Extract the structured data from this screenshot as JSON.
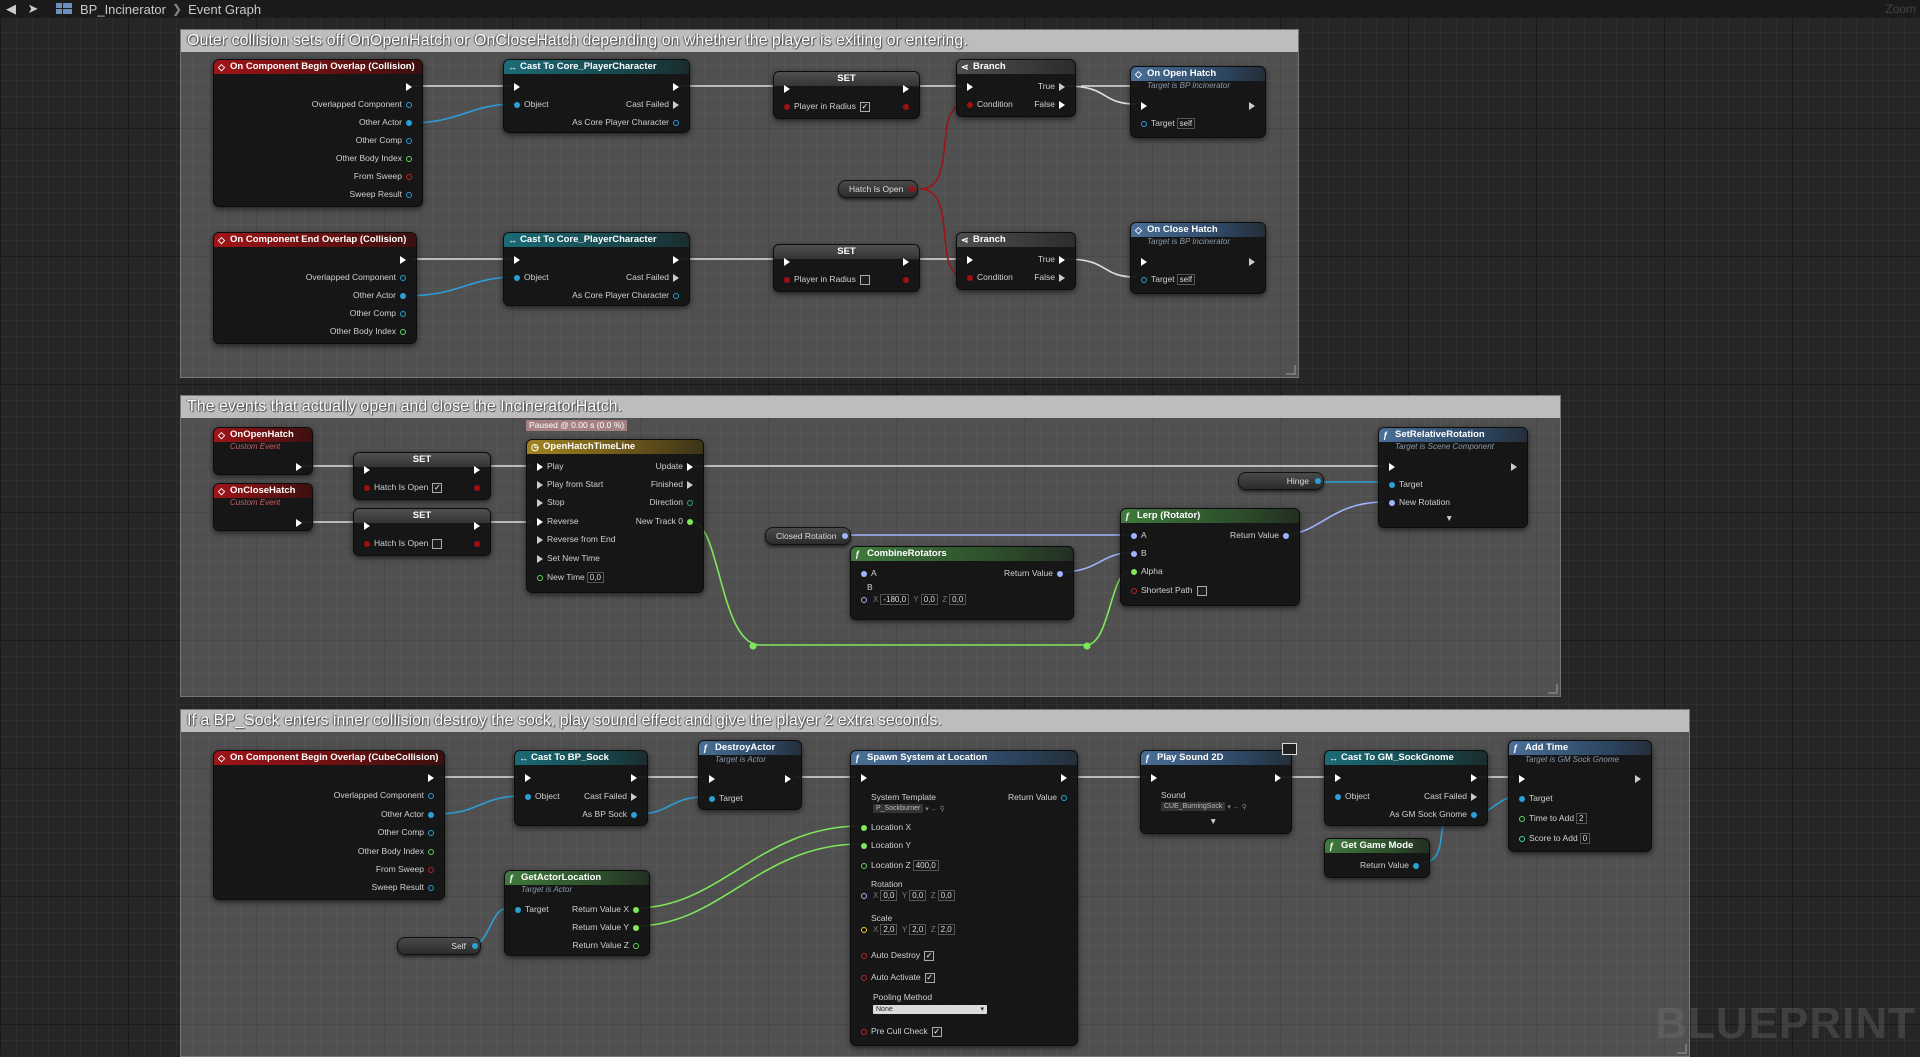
{
  "topbar": {
    "blueprint_name": "BP_Incinerator",
    "graph_name": "Event Graph",
    "zoom_label": "Zoom"
  },
  "watermark": "BLUEPRINT",
  "comments": [
    {
      "title": "Outer collision sets off OnOpenHatch or OnCloseHatch depending on whether the player is exiting or entering."
    },
    {
      "title": "The events that actually open and close the IncineratorHatch."
    },
    {
      "title": "If a BP_Sock enters inner collision destroy the sock, play sound effect and give the player 2 extra seconds."
    }
  ],
  "section1": {
    "begin_overlap": {
      "title": "On Component Begin Overlap (Collision)",
      "pins": [
        "Overlapped Component",
        "Other Actor",
        "Other Comp",
        "Other Body Index",
        "From Sweep",
        "Sweep Result"
      ]
    },
    "end_overlap": {
      "title": "On Component End Overlap (Collision)",
      "pins": [
        "Overlapped Component",
        "Other Actor",
        "Other Comp",
        "Other Body Index"
      ]
    },
    "cast1": {
      "title": "Cast To Core_PlayerCharacter",
      "object": "Object",
      "failed": "Cast Failed",
      "as": "As Core Player Character"
    },
    "cast2": {
      "title": "Cast To Core_PlayerCharacter",
      "object": "Object",
      "failed": "Cast Failed",
      "as": "As Core Player Character"
    },
    "set1": {
      "title": "SET",
      "label": "Player in Radius",
      "checked": true
    },
    "set2": {
      "title": "SET",
      "label": "Player in Radius",
      "checked": false
    },
    "branch1": {
      "title": "Branch",
      "condition": "Condition",
      "true": "True",
      "false": "False"
    },
    "branch2": {
      "title": "Branch",
      "condition": "Condition",
      "true": "True",
      "false": "False"
    },
    "hatch_var": "Hatch Is Open",
    "open_hatch": {
      "title": "On Open Hatch",
      "sub": "Target is BP Incinerator",
      "target": "Target",
      "self": "self"
    },
    "close_hatch": {
      "title": "On Close Hatch",
      "sub": "Target is BP Incinerator",
      "target": "Target",
      "self": "self"
    }
  },
  "section2": {
    "on_open": {
      "title": "OnOpenHatch",
      "sub": "Custom Event"
    },
    "on_close": {
      "title": "OnCloseHatch",
      "sub": "Custom Event"
    },
    "set_open": {
      "title": "SET",
      "label": "Hatch Is Open",
      "checked": true
    },
    "set_close": {
      "title": "SET",
      "label": "Hatch Is Open",
      "checked": false
    },
    "paused": "Paused @ 0.00 s (0.0 %)",
    "timeline": {
      "title": "OpenHatchTimeLine",
      "inputs": [
        "Play",
        "Play from Start",
        "Stop",
        "Reverse",
        "Reverse from End",
        "Set New Time",
        "New Time"
      ],
      "new_time": "0,0",
      "outputs": [
        "Update",
        "Finished",
        "Direction",
        "New Track 0"
      ]
    },
    "closed_rot": "Closed Rotation",
    "combine": {
      "title": "CombineRotators",
      "a": "A",
      "b": "B",
      "ret": "Return Value",
      "x": "-180,0",
      "y": "0,0",
      "z": "0,0"
    },
    "lerp": {
      "title": "Lerp (Rotator)",
      "a": "A",
      "b": "B",
      "alpha": "Alpha",
      "shortest": "Shortest Path",
      "ret": "Return Value"
    },
    "hinge": "Hinge",
    "set_rel_rot": {
      "title": "SetRelativeRotation",
      "sub": "Target is Scene Component",
      "target": "Target",
      "new_rot": "New Rotation"
    }
  },
  "section3": {
    "begin_overlap": {
      "title": "On Component Begin Overlap (CubeCollision)",
      "pins": [
        "Overlapped Component",
        "Other Actor",
        "Other Comp",
        "Other Body Index",
        "From Sweep",
        "Sweep Result"
      ]
    },
    "cast_sock": {
      "title": "Cast To BP_Sock",
      "object": "Object",
      "failed": "Cast Failed",
      "as": "As BP Sock"
    },
    "destroy": {
      "title": "DestroyActor",
      "sub": "Target is Actor",
      "target": "Target"
    },
    "spawn": {
      "title": "Spawn System at Location",
      "template_label": "System Template",
      "template_val": "P_Sockburner",
      "ret": "Return Value",
      "loc_x": "Location X",
      "loc_y": "Location Y",
      "loc_z": "Location Z",
      "loc_z_val": "400,0",
      "rotation": "Rotation",
      "rot": [
        "0,0",
        "0,0",
        "0,0"
      ],
      "scale": "Scale",
      "scale_v": [
        "2,0",
        "2,0",
        "2,0"
      ],
      "auto_destroy": "Auto Destroy",
      "auto_activate": "Auto Activate",
      "pooling": "Pooling Method",
      "pooling_val": "None",
      "pre_cull": "Pre Cull Check"
    },
    "get_loc": {
      "title": "GetActorLocation",
      "sub": "Target is Actor",
      "target": "Target",
      "rx": "Return Value X",
      "ry": "Return Value Y",
      "rz": "Return Value Z"
    },
    "self_var": "Self",
    "play_sound": {
      "title": "Play Sound 2D",
      "sound": "Sound",
      "sound_val": "CUE_BurningSock"
    },
    "cast_gm": {
      "title": "Cast To GM_SockGnome",
      "object": "Object",
      "failed": "Cast Failed",
      "as": "As GM Sock Gnome"
    },
    "get_gm": {
      "title": "Get Game Mode",
      "ret": "Return Value"
    },
    "add_time": {
      "title": "Add Time",
      "sub": "Target is GM Sock Gnome",
      "target": "Target",
      "time_label": "Time to Add",
      "time_val": "2",
      "score_label": "Score to Add",
      "score_val": "0"
    }
  },
  "colors": {
    "exec": "#ffffff",
    "object": "#0a8cc7",
    "bool": "#a01010",
    "float": "#7ee85a",
    "rotator": "#9fb4ff",
    "vector": "#f5c425"
  }
}
